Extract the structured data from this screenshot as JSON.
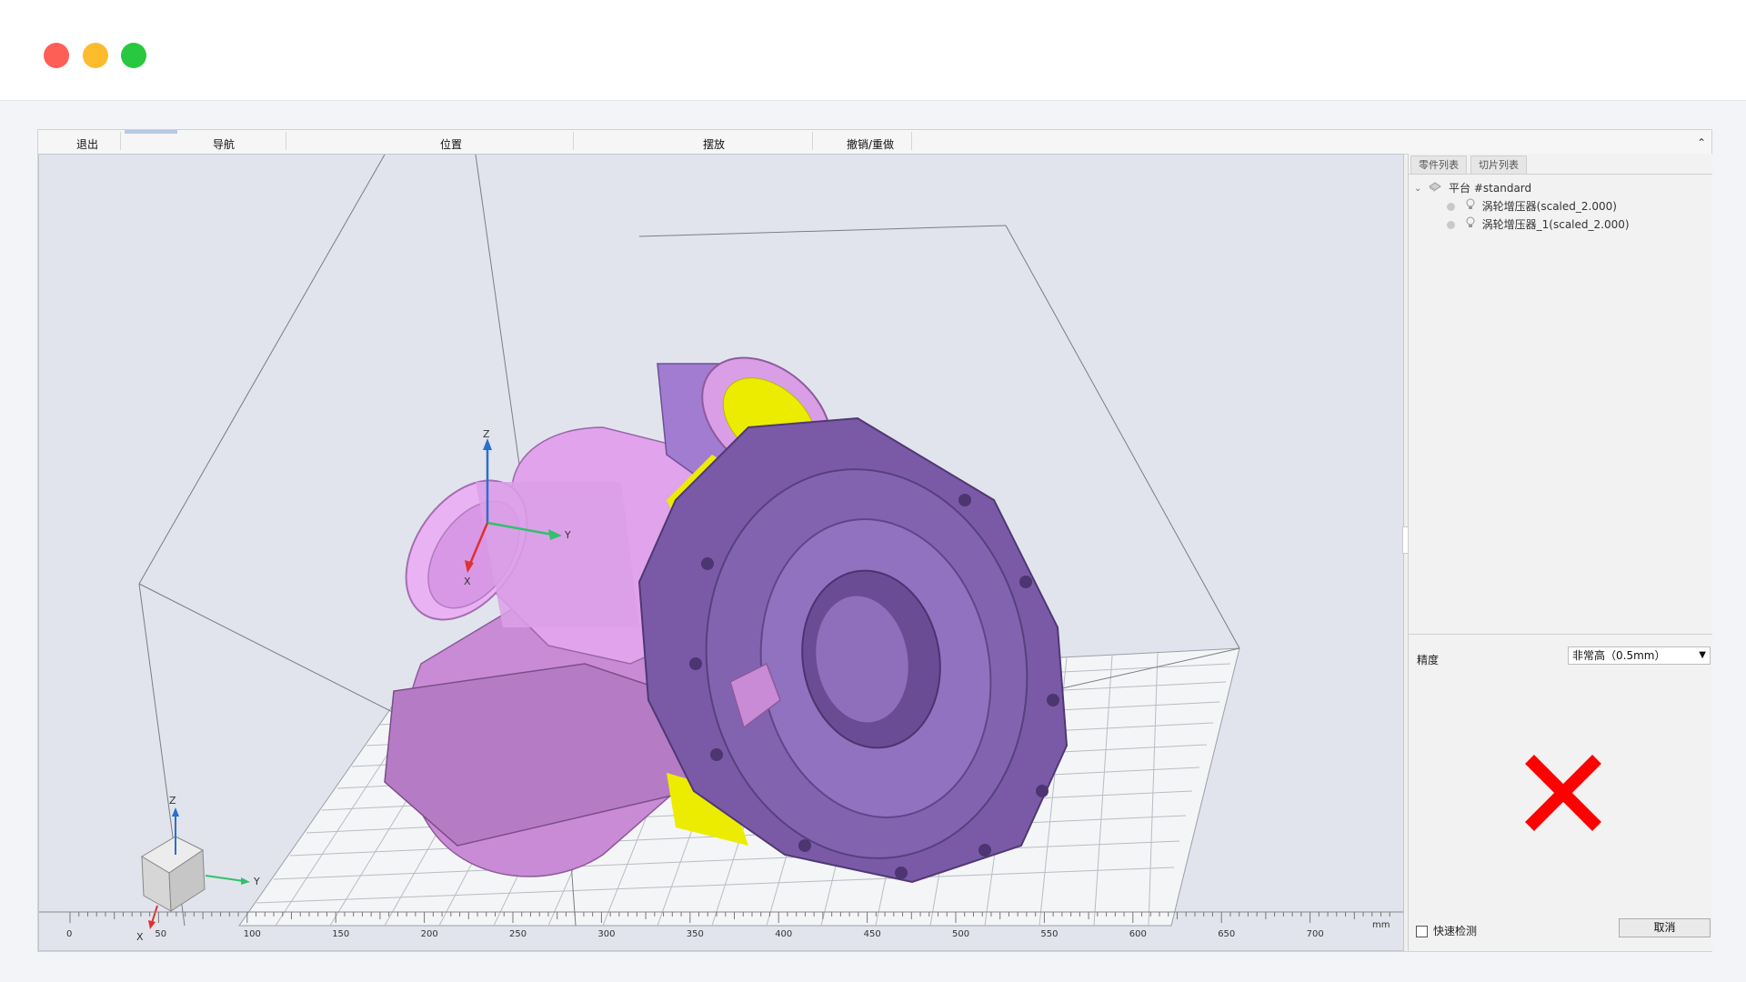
{
  "window": {
    "controls": [
      "close",
      "minimize",
      "zoom"
    ]
  },
  "toolbar": {
    "exit": "退出",
    "navigate": "导航",
    "position": "位置",
    "placement": "摆放",
    "undo_redo": "撤销/重做",
    "collapse": "⌃"
  },
  "viewport": {
    "axes_labels": {
      "x": "X",
      "y": "Y",
      "z": "Z"
    },
    "ruler": {
      "unit": "mm",
      "ticks": [
        "0",
        "50",
        "100",
        "150",
        "200",
        "250",
        "300",
        "350",
        "400",
        "450",
        "500",
        "550",
        "600",
        "650",
        "700"
      ]
    },
    "colors": {
      "light_part": "#e3a6ee",
      "dark_part": "#7d5ca8",
      "highlight": "#ecec00",
      "background": "#e1e4ec"
    }
  },
  "panel": {
    "tabs": [
      "零件列表",
      "切片列表"
    ],
    "tree": {
      "root": "平台 #standard",
      "items": [
        "涡轮增压器(scaled_2.000)",
        "涡轮增压器_1(scaled_2.000)"
      ]
    },
    "precision_label": "精度",
    "precision_value": "非常高（0.5mm）",
    "quick_check_label": "快速检测",
    "cancel_label": "取消",
    "status_icon": "error-x-icon",
    "status_color": "#ff0000"
  }
}
